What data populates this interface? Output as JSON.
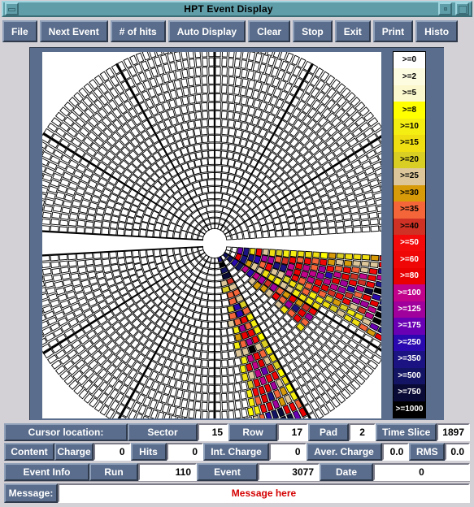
{
  "window": {
    "title": "HPT Event Display",
    "minimize_label": "minimize",
    "restore_label": "restore",
    "maximize_label": "maximize"
  },
  "toolbar": {
    "buttons": [
      {
        "label": "File"
      },
      {
        "label": "Next Event"
      },
      {
        "label": "# of hits"
      },
      {
        "label": "Auto Display"
      },
      {
        "label": "Clear"
      },
      {
        "label": "Stop"
      },
      {
        "label": "Exit"
      },
      {
        "label": "Print"
      },
      {
        "label": "Histo"
      }
    ]
  },
  "legend": {
    "title": "charge-threshold-colour-scale",
    "cells": [
      {
        "label": ">=0",
        "bg": "#ffffff",
        "fg": "#000000"
      },
      {
        "label": ">=2",
        "bg": "#fdfbe0",
        "fg": "#000000"
      },
      {
        "label": ">=5",
        "bg": "#fcf8cd",
        "fg": "#000000"
      },
      {
        "label": ">=8",
        "bg": "#ffff00",
        "fg": "#000000"
      },
      {
        "label": ">=10",
        "bg": "#f5ee12",
        "fg": "#000000"
      },
      {
        "label": ">=15",
        "bg": "#eede12",
        "fg": "#000000"
      },
      {
        "label": ">=20",
        "bg": "#d9cf24",
        "fg": "#000000"
      },
      {
        "label": ">=25",
        "bg": "#ddc79a",
        "fg": "#000000"
      },
      {
        "label": ">=30",
        "bg": "#d79b0a",
        "fg": "#000000"
      },
      {
        "label": ">=35",
        "bg": "#f4663a",
        "fg": "#000000"
      },
      {
        "label": ">=40",
        "bg": "#cf3224",
        "fg": "#000000"
      },
      {
        "label": ">=50",
        "bg": "#f40a0a",
        "fg": "#ffffff"
      },
      {
        "label": ">=60",
        "bg": "#ef0606",
        "fg": "#ffffff"
      },
      {
        "label": ">=80",
        "bg": "#e90000",
        "fg": "#ffffff"
      },
      {
        "label": ">=100",
        "bg": "#c1038b",
        "fg": "#ffffff"
      },
      {
        "label": ">=125",
        "bg": "#a0009b",
        "fg": "#ffffff"
      },
      {
        "label": ">=175",
        "bg": "#6a00b4",
        "fg": "#ffffff"
      },
      {
        "label": ">=250",
        "bg": "#2a0ab0",
        "fg": "#ffffff"
      },
      {
        "label": ">=350",
        "bg": "#1b1382",
        "fg": "#ffffff"
      },
      {
        "label": ">=500",
        "bg": "#131464",
        "fg": "#ffffff"
      },
      {
        "label": ">=750",
        "bg": "#0a0a36",
        "fg": "#ffffff"
      },
      {
        "label": ">=1000",
        "bg": "#000000",
        "fg": "#ffffff"
      }
    ]
  },
  "cursor_row": {
    "panel_label": "Cursor location:",
    "sector_label": "Sector",
    "sector_value": "15",
    "row_label": "Row",
    "row_value": "17",
    "pad_label": "Pad",
    "pad_value": "2",
    "timeslice_label": "Time Slice",
    "timeslice_value": "1897"
  },
  "content_row": {
    "panel_label": "Content",
    "charge_label": "Charge",
    "charge_value": "0",
    "hits_label": "Hits",
    "hits_value": "0",
    "int_charge_label": "Int. Charge",
    "int_charge_value": "0",
    "aver_charge_label": "Aver. Charge",
    "aver_charge_value": "0.0",
    "rms_label": "RMS",
    "rms_value": "0.0"
  },
  "event_row": {
    "panel_label": "Event Info",
    "run_label": "Run",
    "run_value": "110",
    "event_label": "Event",
    "event_value": "3077",
    "date_label": "Date",
    "date_value": "0"
  },
  "message_row": {
    "label": "Message:",
    "text": "Message here"
  },
  "plot": {
    "name": "hpt-detector-pad-plane",
    "background": "#ffffff",
    "grid_color": "#000000",
    "description": "Polar pad-plane of a time projection chamber split into upper and lower half-planes; coloured pads show charge deposits along reconstructed tracks."
  }
}
